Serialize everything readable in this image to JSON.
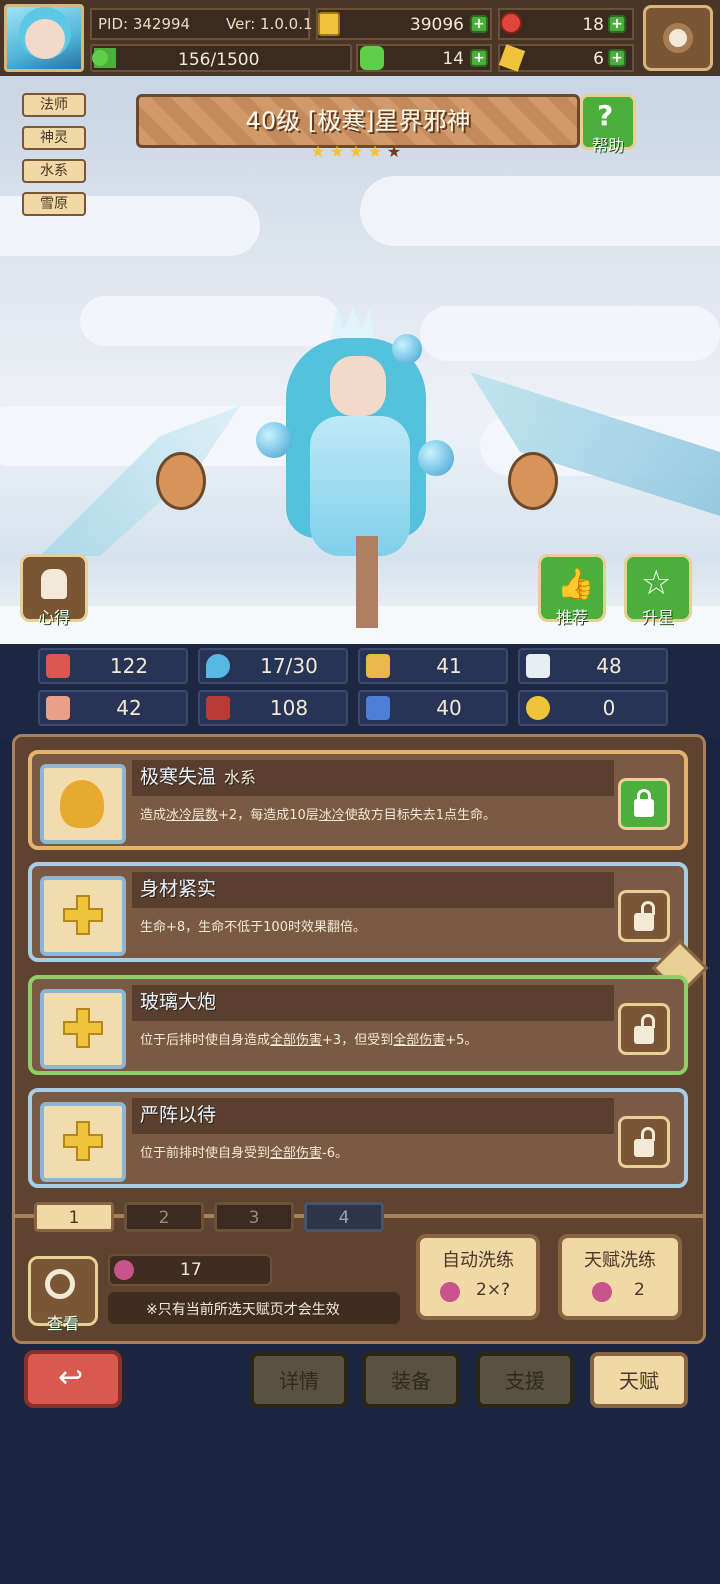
{
  "player": {
    "pid": "PID: 342994",
    "version": "Ver: 1.0.0.1",
    "exp": "156/1500"
  },
  "currencies": {
    "gold": "39096",
    "gem": "18",
    "clover": "14",
    "ticket": "6"
  },
  "tags": [
    "法师",
    "神灵",
    "水系",
    "雪原"
  ],
  "hero": {
    "title": "40级 [极寒]星界邪神",
    "stars": 4,
    "max_stars": 5
  },
  "buttons": {
    "help": "帮助",
    "insight": "心得",
    "recommend": "推荐",
    "star_up": "升星"
  },
  "stats": {
    "hp": "122",
    "mana": "17/30",
    "defense": "41",
    "speed": "48",
    "attack": "42",
    "magic": "108",
    "boots": "40",
    "other": "0"
  },
  "talents": [
    {
      "name": "极寒失温",
      "type": "水系",
      "desc_parts": [
        "造成",
        "冰冷层数",
        "+2，每造成10层",
        "冰冷",
        "使敌方目标失去1点生命。"
      ]
    },
    {
      "name": "身材紧实",
      "type": "",
      "desc_parts": [
        "生命+8，生命不低于100时效果翻倍。"
      ]
    },
    {
      "name": "玻璃大炮",
      "type": "",
      "desc_parts": [
        "位于后排时使自身造成",
        "全部伤害",
        "+3，但受到",
        "全部伤害",
        "+5。"
      ]
    },
    {
      "name": "严阵以待",
      "type": "",
      "desc_parts": [
        "位于前排时使自身受到",
        "全部伤害",
        "-6。"
      ]
    }
  ],
  "pages": [
    "1",
    "2",
    "3",
    "4"
  ],
  "talent_footer": {
    "view": "查看",
    "potion_count": "17",
    "note": "※只有当前所选天赋页才会生效",
    "auto_reroll": "自动洗练",
    "auto_cost": "2×?",
    "talent_reroll": "天赋洗练",
    "talent_cost": "2"
  },
  "bottom_tabs": {
    "details": "详情",
    "equipment": "装备",
    "support": "支援",
    "talent": "天赋"
  },
  "colors": {
    "accent_green": "#4caf3c",
    "panel_brown": "#5e4331",
    "frame_gold": "#e8cf93"
  }
}
